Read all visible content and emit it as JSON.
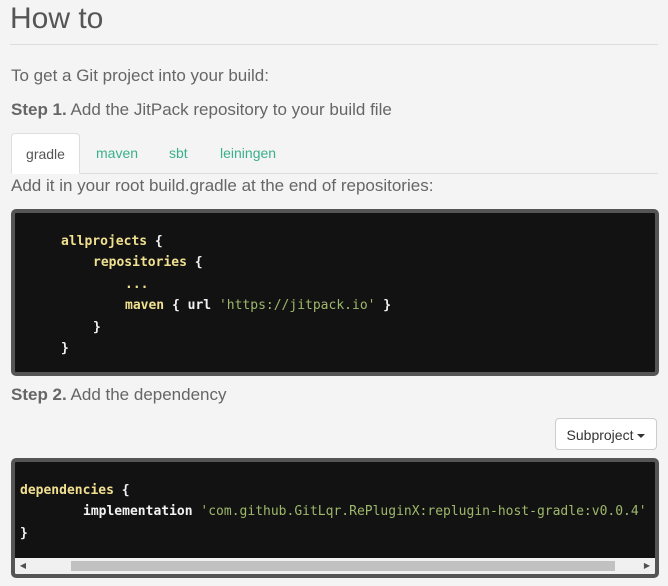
{
  "header": {
    "title": "How to"
  },
  "intro": "To get a Git project into your build:",
  "step1": {
    "label": "Step 1.",
    "text": " Add the JitPack repository to your build file"
  },
  "tabs": [
    {
      "label": "gradle",
      "active": true
    },
    {
      "label": "maven",
      "active": false
    },
    {
      "label": "sbt",
      "active": false
    },
    {
      "label": "leiningen",
      "active": false
    }
  ],
  "hint": "Add it in your root build.gradle at the end of repositories:",
  "code1": {
    "lines": [
      {
        "a": "allprojects",
        "b": " {"
      },
      {
        "a": "repositories",
        "b": " {"
      },
      {
        "a": "...",
        "b": ""
      },
      {
        "a": "maven",
        "b": " { ",
        "c": "url",
        "d": " ",
        "e": "'https://jitpack.io'",
        "f": " }"
      },
      {
        "a": "",
        "b": "}"
      },
      {
        "a": "",
        "b": "}"
      }
    ]
  },
  "step2": {
    "label": "Step 2.",
    "text": " Add the dependency"
  },
  "subproject_button": "Subproject",
  "code2": {
    "lines": [
      {
        "a": "dependencies",
        "b": " {"
      },
      {
        "a": "implementation",
        "b": " ",
        "c": "'com.github.GitLqr.RePluginX:replugin-host-gradle:v0.0.4'"
      },
      {
        "a": "",
        "b": "}"
      }
    ]
  },
  "colors": {
    "accent": "#3ab08c",
    "code_bg": "#121212",
    "keyword": "#f0e090",
    "string": "#9db86b"
  },
  "icons": {
    "scroll_left": "scroll-left-arrow-icon",
    "scroll_right": "scroll-right-arrow-icon",
    "caret": "caret-down-icon"
  }
}
